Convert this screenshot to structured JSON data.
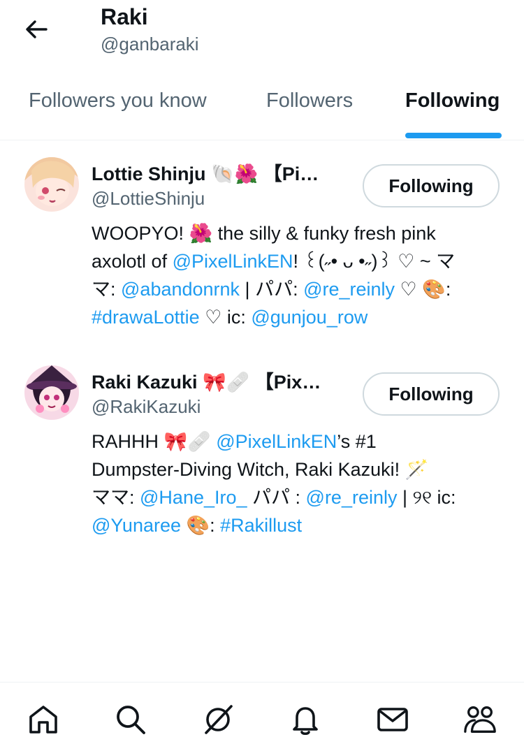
{
  "header": {
    "title": "Raki",
    "handle": "@ganbaraki"
  },
  "tabs": [
    {
      "label": "Followers you know",
      "active": false
    },
    {
      "label": "Followers",
      "active": false
    },
    {
      "label": "Following",
      "active": true
    }
  ],
  "users": [
    {
      "display_name": "Lottie Shinju 🐚🌺 【Pi…",
      "handle": "@LottieShinju",
      "button_label": "Following",
      "bio": {
        "l1_a": "WOOPYO! 🌺 the silly & funky fresh pink",
        "l2_a": "axolotl of ",
        "l2_link": "@PixelLinkEN",
        "l2_b": "! ꒰(˶• ᴗ •˶)꒱ ♡ ~ マ",
        "l3_a": "マ: ",
        "l3_link1": "@abandonrnk",
        "l3_b": " | パパ: ",
        "l3_link2": "@re_reinly",
        "l3_c": " ♡ 🎨:",
        "l4_link1": "#drawaLottie",
        "l4_a": " ♡ ic: ",
        "l4_link2": "@gunjou_row"
      }
    },
    {
      "display_name": "Raki Kazuki 🎀🩹 【Pix…",
      "handle": "@RakiKazuki",
      "button_label": "Following",
      "bio": {
        "l1_a": "RAHHH 🎀🩹 ",
        "l1_link": "@PixelLinkEN",
        "l1_b": "’s #1",
        "l2_a": "Dumpster-Diving Witch, Raki Kazuki! 🪄",
        "l3_a": "ママ: ",
        "l3_link1": "@Hane_Iro_",
        "l3_b": " パパ : ",
        "l3_link2": "@re_reinly",
        "l3_c": " | ୨୧ ic:",
        "l4_link1": "@Yunaree",
        "l4_a": " 🎨: ",
        "l4_link2": "#Rakillust"
      }
    }
  ],
  "nav": [
    "home-icon",
    "search-icon",
    "grok-icon",
    "notifications-icon",
    "messages-icon",
    "communities-icon"
  ],
  "colors": {
    "accent": "#1d9bf0",
    "text": "#0f1419",
    "secondary": "#536471",
    "border": "#cfd9de"
  }
}
